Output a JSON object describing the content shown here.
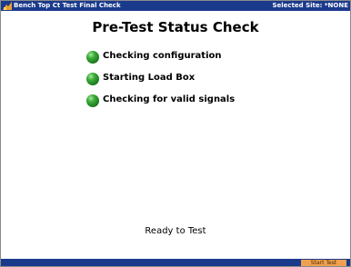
{
  "titlebar": {
    "app_title": "Bench Top Ct Test Final Check",
    "selected_site": "Selected Site: *NONE",
    "bar_color": "#1a3a8c",
    "icon": "app-icon"
  },
  "main": {
    "heading": "Pre-Test Status Check",
    "checks": [
      {
        "label": "Checking configuration",
        "status_icon": "green-led",
        "color": "#2e9a2e"
      },
      {
        "label": "Starting Load Box",
        "status_icon": "green-led",
        "color": "#2e9a2e"
      },
      {
        "label": "Checking for valid signals",
        "status_icon": "green-led",
        "color": "#2e9a2e"
      }
    ],
    "status_text": "Ready to Test"
  },
  "bottombar": {
    "start_button_label": "Start Test",
    "button_color": "#f0a050"
  }
}
